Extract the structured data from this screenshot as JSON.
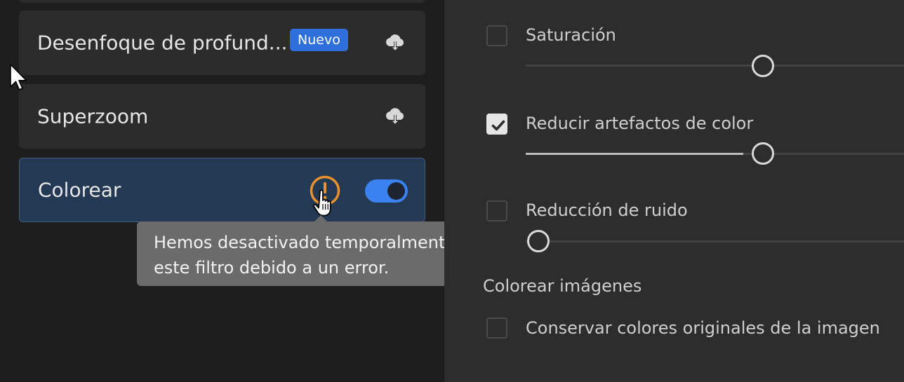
{
  "filters": {
    "items": [
      {
        "label": "Desenfoque de profund...",
        "badge": "Nuevo"
      },
      {
        "label": "Superzoom"
      },
      {
        "label": "Colorear",
        "enabled": true
      }
    ],
    "tooltip": "Hemos desactivado temporalmente este filtro debido a un error."
  },
  "settings": {
    "saturation_label": "Saturación",
    "saturation_checked": false,
    "saturation_value": 0.61,
    "color_artifacts_label": "Reducir artefactos de color",
    "color_artifacts_checked": true,
    "color_artifacts_value": 0.61,
    "noise_label": "Reducción de ruido",
    "noise_checked": false,
    "noise_value": 0.0,
    "section_title": "Colorear imágenes",
    "preserve_label": "Conservar colores originales de la imagen",
    "preserve_checked": false
  },
  "colors": {
    "accent": "#3a82f0",
    "badge": "#2f6fdb",
    "warning": "#e8922e",
    "selected_card": "#233954"
  },
  "icons": {
    "download": "cloud-download-icon",
    "warning": "warning-icon",
    "check": "checkmark-icon"
  }
}
